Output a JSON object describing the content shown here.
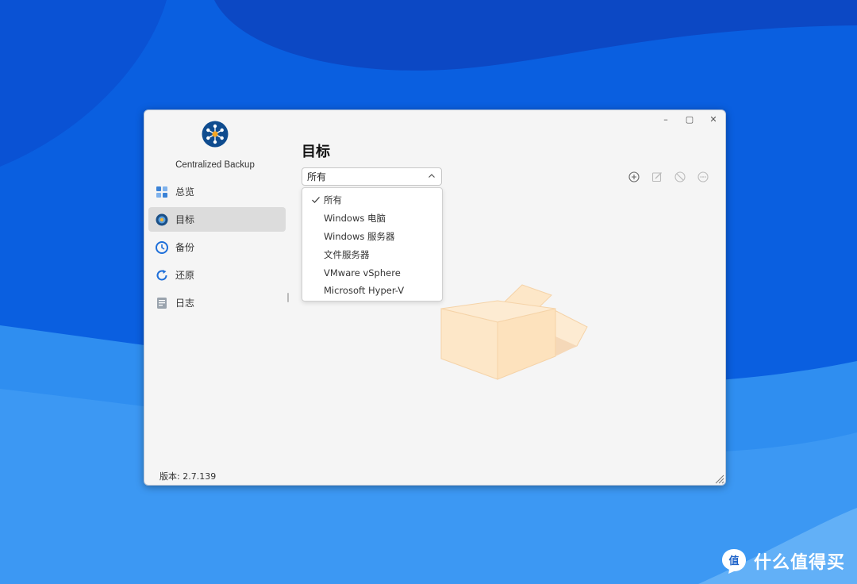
{
  "window": {
    "controls": {
      "minimize": "–",
      "maximize": "▢",
      "close": "✕"
    }
  },
  "sidebar": {
    "app_name": "Centralized Backup",
    "items": [
      {
        "label": "总览",
        "icon": "dashboard-icon"
      },
      {
        "label": "目标",
        "icon": "target-icon",
        "active": true
      },
      {
        "label": "备份",
        "icon": "backup-clock-icon"
      },
      {
        "label": "还原",
        "icon": "restore-icon"
      },
      {
        "label": "日志",
        "icon": "log-icon"
      }
    ],
    "version": "版本: 2.7.139"
  },
  "main": {
    "title": "目标",
    "filter": {
      "selected": "所有",
      "options": [
        "所有",
        "Windows 电脑",
        "Windows 服务器",
        "文件服务器",
        "VMware vSphere",
        "Microsoft Hyper-V"
      ]
    },
    "toolbar": [
      "add-icon",
      "edit-icon",
      "disable-icon",
      "more-icon"
    ]
  },
  "watermark": {
    "text": "什么值得买",
    "logo_char": "值"
  },
  "colors": {
    "accent": "#1565d8",
    "active_nav": "#dcdcdc",
    "illustration": "#fde7c8"
  }
}
